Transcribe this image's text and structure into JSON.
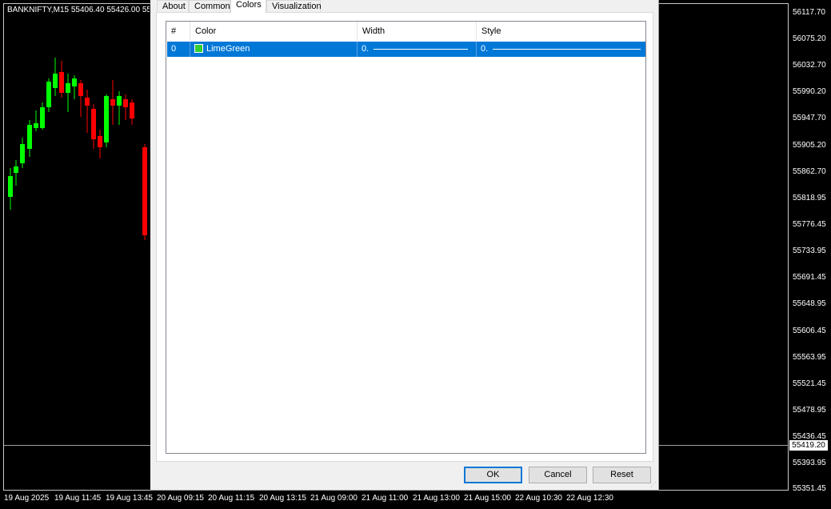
{
  "chart": {
    "title": "BANKNIFTY,M15  55406.40 55426.00 55",
    "price_labels": [
      "56117.70",
      "56075.20",
      "56032.70",
      "55990.20",
      "55947.70",
      "55905.20",
      "55862.70",
      "55818.95",
      "55776.45",
      "55733.95",
      "55691.45",
      "55648.95",
      "55606.45",
      "55563.95",
      "55521.45",
      "55478.95",
      "55436.45",
      "55393.95",
      "55351.45"
    ],
    "current_price": "55419.20",
    "time_labels": [
      "19 Aug 2025",
      "19 Aug 11:45",
      "19 Aug 13:45",
      "20 Aug 09:15",
      "20 Aug 11:15",
      "20 Aug 13:15",
      "21 Aug 09:00",
      "21 Aug 11:00",
      "21 Aug 13:00",
      "21 Aug 15:00",
      "22 Aug 10:30",
      "22 Aug 12:30"
    ],
    "colors": {
      "bull": "#00ff00",
      "bear": "#ff0000",
      "background": "#000000"
    }
  },
  "dialog": {
    "tabs": [
      {
        "label": "About",
        "active": false
      },
      {
        "label": "Common",
        "active": false
      },
      {
        "label": "Colors",
        "active": true
      },
      {
        "label": "Visualization",
        "active": false
      }
    ],
    "table": {
      "headers": [
        "#",
        "Color",
        "Width",
        "Style"
      ],
      "rows": [
        {
          "index": "0",
          "color_name": "LimeGreen",
          "color_hex": "#32cd32",
          "width": "0.",
          "style": "0."
        }
      ],
      "selection_color": "#0078d7"
    },
    "buttons": {
      "ok": "OK",
      "cancel": "Cancel",
      "reset": "Reset"
    }
  }
}
